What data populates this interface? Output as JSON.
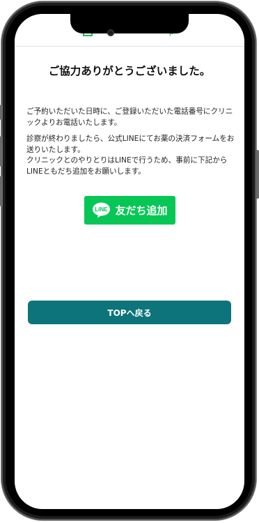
{
  "header": {
    "logo_text_right": "p"
  },
  "page": {
    "title": "ご協力ありがとうございました。",
    "message_1": "ご予約いただいた日時に、ご登録いただいた電話番号にクリニックよりお電話いたします。",
    "message_2_line_1": "診察が終わりましたら、公式LINEにてお薬の決済フォームをお送りいたします。",
    "message_2_line_2": "クリニックとのやりとりはLINEで行うため、事前に下記からLINEともだち追加をお願いします。"
  },
  "line_button": {
    "label": "友だち追加",
    "icon_text": "LINE",
    "icon": "line-logo-icon",
    "color": "#06c755"
  },
  "top_button": {
    "label": "TOPへ戻る",
    "color": "#0e747b"
  }
}
